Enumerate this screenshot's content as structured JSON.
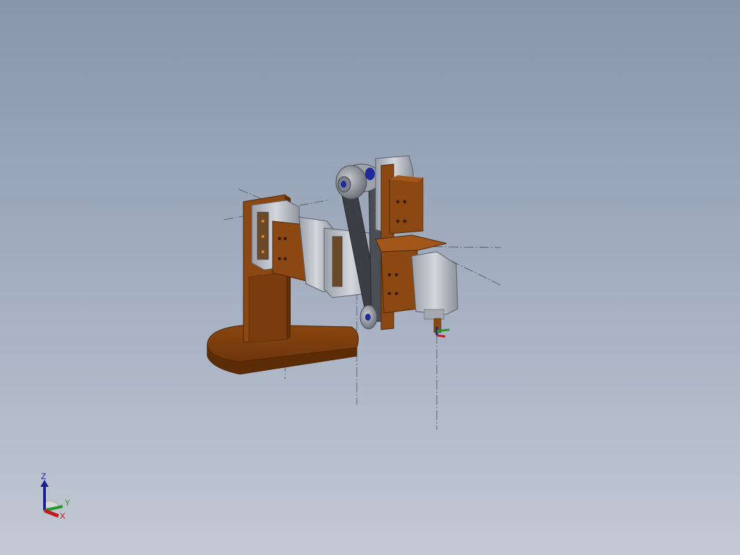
{
  "viewport": {
    "background_top": "#8896ab",
    "background_bottom": "#c3c9d4"
  },
  "model": {
    "part_color": "#7a3d0c",
    "part_highlight": "#9a4e14",
    "motor_color": "#b8bcc4",
    "pulley_color": "#8f949c",
    "belt_color": "#3b3e44"
  },
  "triad": {
    "z_label": "Z",
    "y_label": "Y",
    "x_label": "X",
    "z_color": "#1a1f8f",
    "y_color": "#1d9a2a",
    "x_color": "#c0181c"
  }
}
